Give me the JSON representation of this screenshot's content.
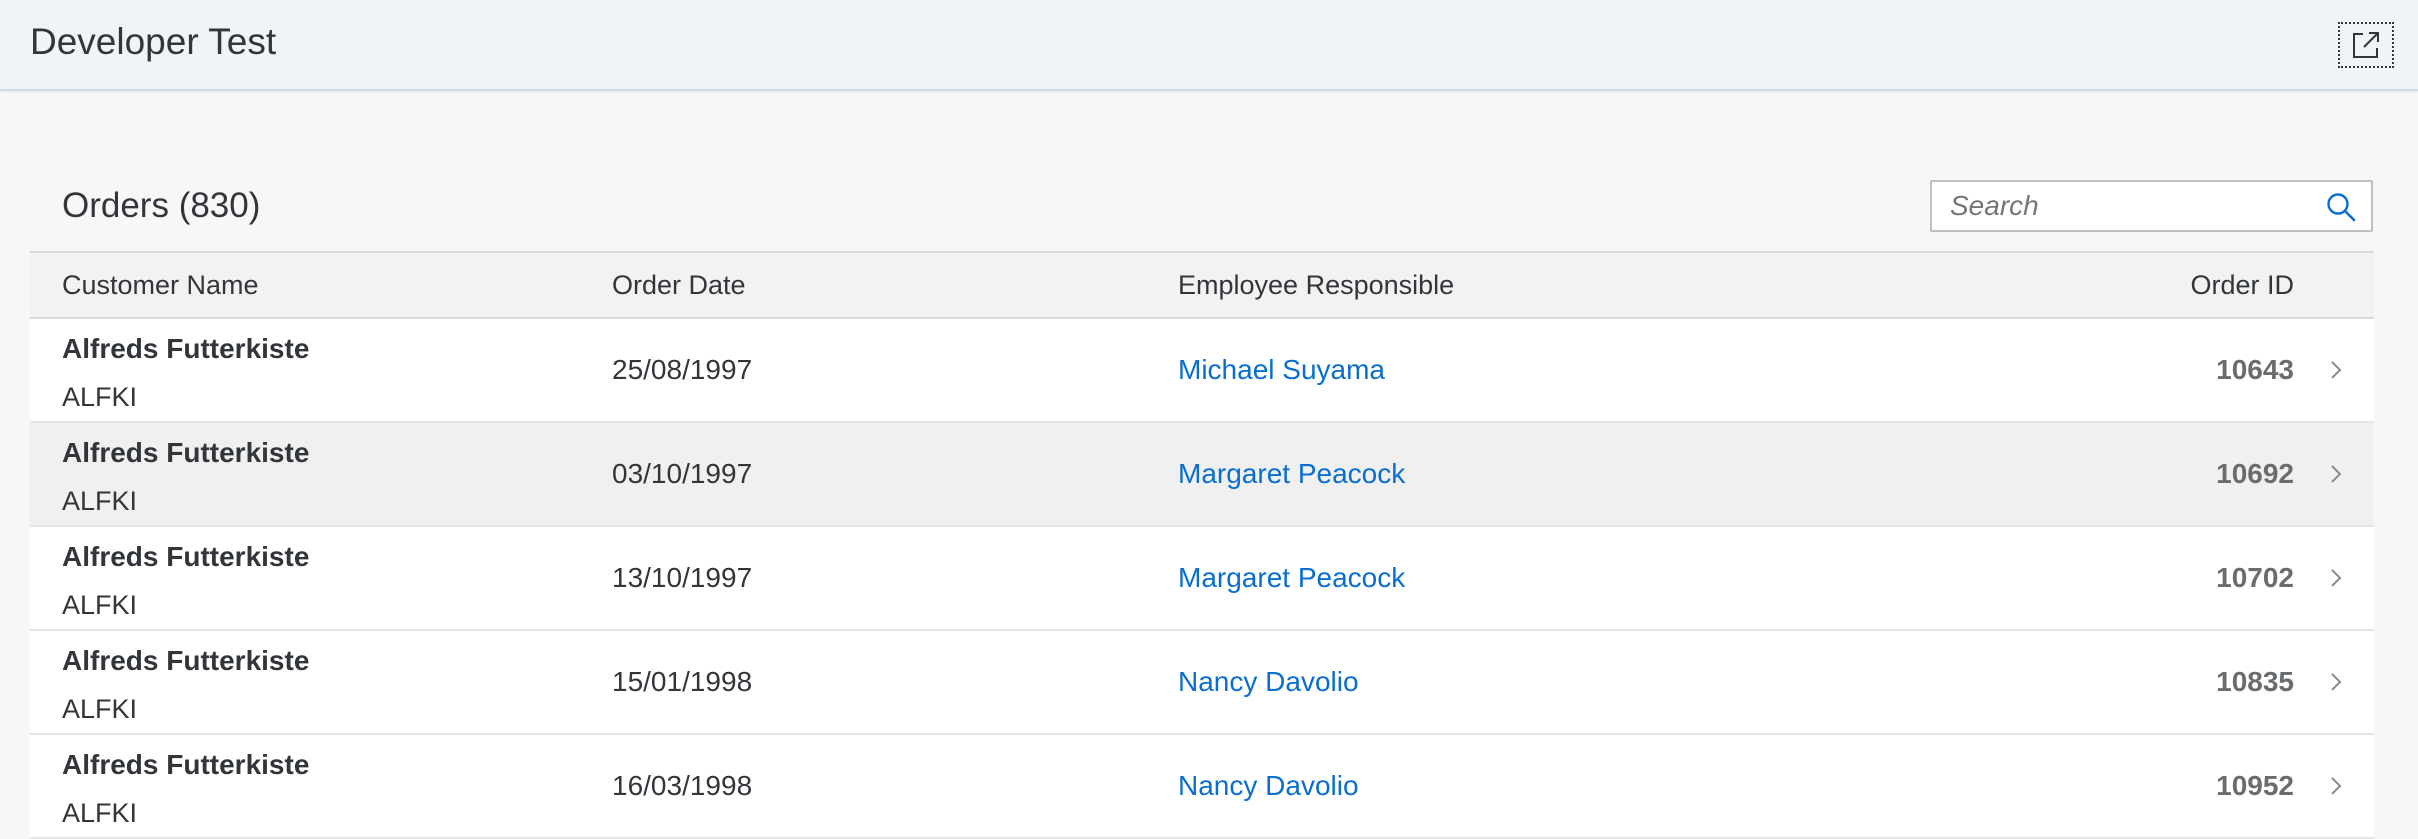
{
  "shell": {
    "title": "Developer Test",
    "share_icon": "share-icon"
  },
  "list": {
    "title": "Orders (830)",
    "search": {
      "placeholder": "Search",
      "icon": "search-icon"
    },
    "columns": {
      "customer": "Customer Name",
      "date": "Order Date",
      "employee": "Employee Responsible",
      "order_id": "Order ID"
    },
    "rows": [
      {
        "customer_name": "Alfreds Futterkiste",
        "customer_id": "ALFKI",
        "date": "25/08/1997",
        "employee": "Michael Suyama",
        "order_id": "10643"
      },
      {
        "customer_name": "Alfreds Futterkiste",
        "customer_id": "ALFKI",
        "date": "03/10/1997",
        "employee": "Margaret Peacock",
        "order_id": "10692"
      },
      {
        "customer_name": "Alfreds Futterkiste",
        "customer_id": "ALFKI",
        "date": "13/10/1997",
        "employee": "Margaret Peacock",
        "order_id": "10702"
      },
      {
        "customer_name": "Alfreds Futterkiste",
        "customer_id": "ALFKI",
        "date": "15/01/1998",
        "employee": "Nancy Davolio",
        "order_id": "10835"
      },
      {
        "customer_name": "Alfreds Futterkiste",
        "customer_id": "ALFKI",
        "date": "16/03/1998",
        "employee": "Nancy Davolio",
        "order_id": "10952"
      }
    ]
  },
  "colors": {
    "shell_bg": "#eff4f9",
    "link": "#0a6ed1",
    "text": "#32363a",
    "hover_row": "#f0f0f0"
  }
}
